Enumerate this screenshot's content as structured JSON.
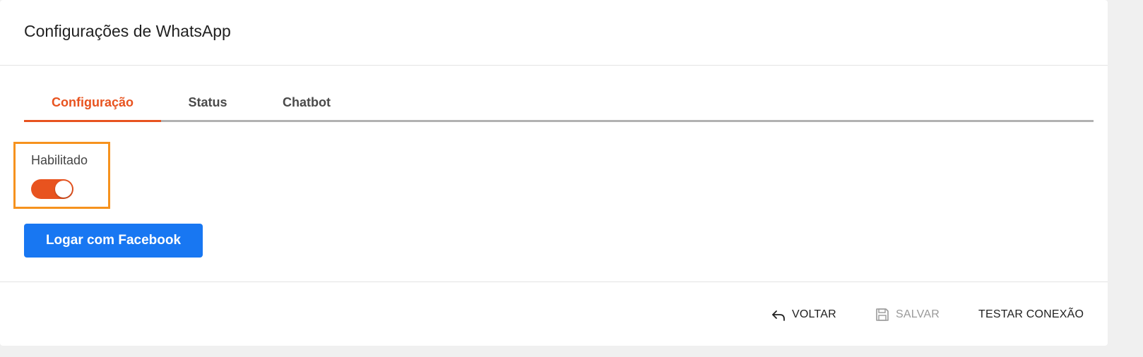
{
  "dialog": {
    "title": "Configurações de WhatsApp"
  },
  "tabs": [
    {
      "label": "Configuração",
      "active": true
    },
    {
      "label": "Status",
      "active": false
    },
    {
      "label": "Chatbot",
      "active": false
    }
  ],
  "form": {
    "enabled_label": "Habilitado",
    "enabled": true,
    "facebook_button_label": "Logar com Facebook"
  },
  "footer": {
    "back_label": "VOLTAR",
    "back_icon": "undo-arrow-icon",
    "save_label": "SALVAR",
    "save_icon": "floppy-disk-icon",
    "save_disabled": true,
    "test_label": "TESTAR CONEXÃO"
  },
  "colors": {
    "accent": "#e8531f",
    "highlight_box": "#f6921e",
    "facebook_blue": "#1877f2"
  }
}
